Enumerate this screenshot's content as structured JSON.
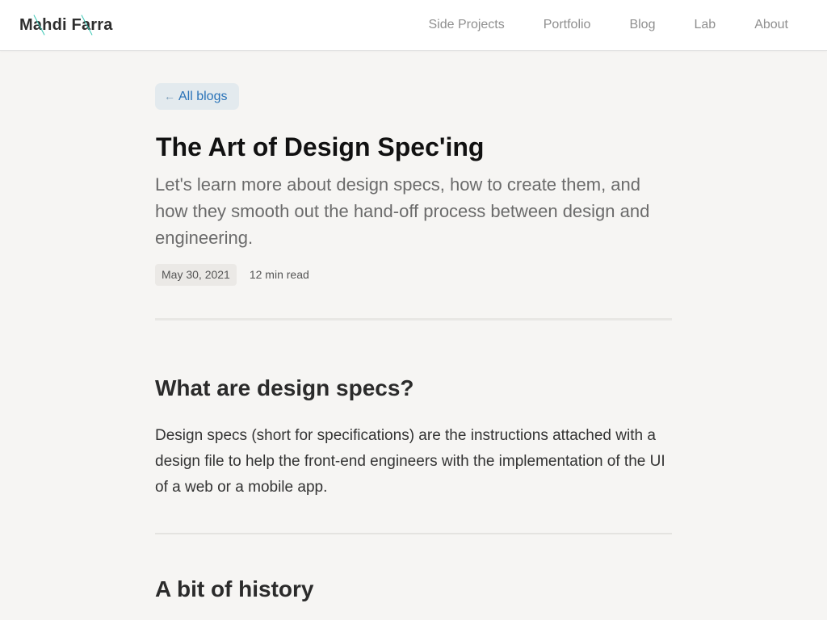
{
  "header": {
    "logo": "Mahdi Farra",
    "accent_color": "#38c7b4",
    "nav": [
      {
        "label": "Side Projects"
      },
      {
        "label": "Portfolio"
      },
      {
        "label": "Blog"
      },
      {
        "label": "Lab"
      },
      {
        "label": "About"
      }
    ]
  },
  "article": {
    "back_label": "All blogs",
    "back_arrow": "←",
    "title": "The Art of Design Spec'ing",
    "subtitle": "Let's learn more about design specs, how to create them, and how they smooth out the hand-off process between design and engineering.",
    "date": "May 30, 2021",
    "read_time": "12 min read",
    "sections": [
      {
        "heading": "What are design specs?",
        "body": "Design specs (short for specifications) are the instructions attached with a design file to help the front-end engineers with the implementation of the UI of a web or a mobile app."
      },
      {
        "heading": "A bit of history",
        "body": ""
      }
    ]
  },
  "colors": {
    "background": "#f6f5f3",
    "link": "#2a73b8",
    "back_button_bg": "#e3eaee"
  }
}
